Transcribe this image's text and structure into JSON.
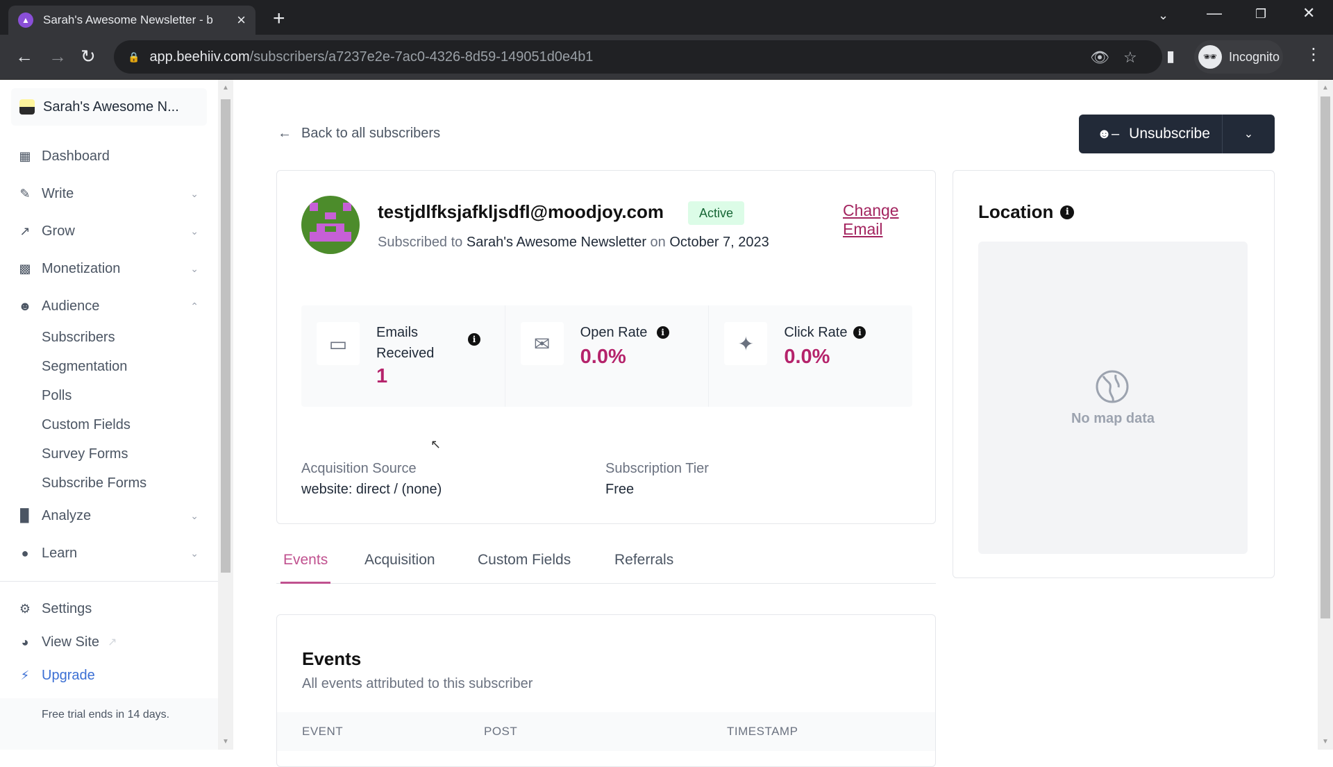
{
  "browser": {
    "tab_title": "Sarah's Awesome Newsletter - b",
    "url_host": "app.beehiiv.com",
    "url_path": "/subscribers/a7237e2e-7ac0-4326-8d59-149051d0e4b1",
    "profile_label": "Incognito"
  },
  "sidebar": {
    "publication_name": "Sarah's Awesome N...",
    "items": [
      {
        "label": "Dashboard",
        "icon": "dashboard-icon"
      },
      {
        "label": "Write",
        "icon": "pencil-icon"
      },
      {
        "label": "Grow",
        "icon": "trending-icon"
      },
      {
        "label": "Monetization",
        "icon": "money-icon"
      },
      {
        "label": "Audience",
        "icon": "users-icon"
      }
    ],
    "audience_subitems": [
      "Subscribers",
      "Segmentation",
      "Polls",
      "Custom Fields",
      "Survey Forms",
      "Subscribe Forms"
    ],
    "items_after": [
      {
        "label": "Analyze",
        "icon": "bar-chart-icon"
      },
      {
        "label": "Learn",
        "icon": "lightbulb-icon"
      }
    ],
    "bottom": {
      "settings": "Settings",
      "view_site": "View Site",
      "upgrade": "Upgrade",
      "trial_notice": "Free trial ends in 14 days."
    }
  },
  "main": {
    "back_link": "Back to all subscribers",
    "unsubscribe_label": "Unsubscribe",
    "subscriber": {
      "email": "testjdlfksjafkljsdfl@moodjoy.com",
      "status": "Active",
      "change_email": "Change Email",
      "subscribed_prefix": "Subscribed to",
      "publication": "Sarah's Awesome Newsletter",
      "on": "on",
      "date": "October 7, 2023"
    },
    "stats": [
      {
        "label_line1": "Emails",
        "label_line2": "Received",
        "value": "1"
      },
      {
        "label": "Open Rate",
        "value": "0.0%"
      },
      {
        "label": "Click Rate",
        "value": "0.0%"
      }
    ],
    "acquisition_source_label": "Acquisition Source",
    "acquisition_source_value": "website: direct / (none)",
    "subscription_tier_label": "Subscription Tier",
    "subscription_tier_value": "Free",
    "location": {
      "title": "Location",
      "empty_text": "No map data"
    },
    "tabs": [
      "Events",
      "Acquisition",
      "Custom Fields",
      "Referrals"
    ],
    "active_tab": "Events",
    "events": {
      "title": "Events",
      "subtitle": "All events attributed to this subscriber",
      "columns": [
        "EVENT",
        "POST",
        "TIMESTAMP"
      ]
    }
  },
  "colors": {
    "accent": "#b5236b",
    "tab_active": "#c0518f",
    "button_dark": "#222a38",
    "status_bg": "#dcfce7",
    "upgrade_blue": "#3b6fd4"
  }
}
